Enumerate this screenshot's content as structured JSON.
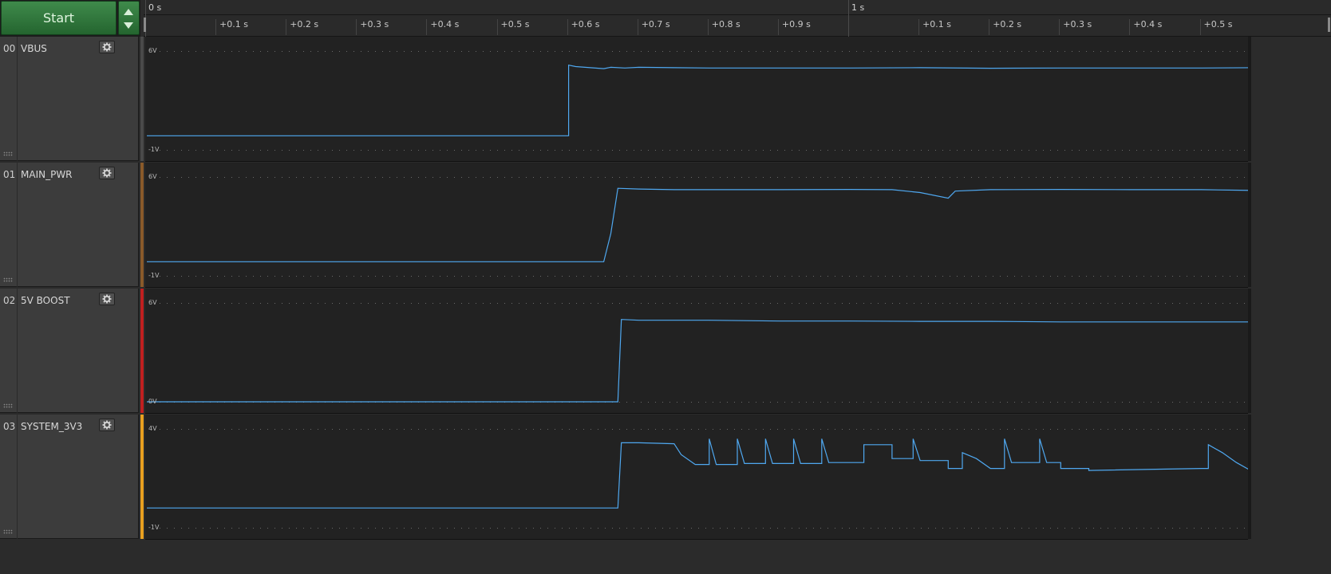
{
  "toolbar": {
    "start_label": "Start",
    "up_icon": "triangle-up-icon",
    "down_icon": "triangle-down-icon"
  },
  "timeline": {
    "major": [
      {
        "label": "0 s",
        "t": 0.0
      },
      {
        "label": "1 s",
        "t": 1.0
      }
    ],
    "minor": [
      {
        "label": "+0.1 s",
        "t": 0.1
      },
      {
        "label": "+0.2 s",
        "t": 0.2
      },
      {
        "label": "+0.3 s",
        "t": 0.3
      },
      {
        "label": "+0.4 s",
        "t": 0.4
      },
      {
        "label": "+0.5 s",
        "t": 0.5
      },
      {
        "label": "+0.6 s",
        "t": 0.6
      },
      {
        "label": "+0.7 s",
        "t": 0.7
      },
      {
        "label": "+0.8 s",
        "t": 0.8
      },
      {
        "label": "+0.9 s",
        "t": 0.9
      },
      {
        "label": "+0.1 s",
        "t": 1.1
      },
      {
        "label": "+0.2 s",
        "t": 1.2
      },
      {
        "label": "+0.3 s",
        "t": 1.3
      },
      {
        "label": "+0.4 s",
        "t": 1.4
      },
      {
        "label": "+0.5 s",
        "t": 1.5
      }
    ],
    "visible_range_s": [
      0.0,
      1.57
    ]
  },
  "channels": [
    {
      "number": "00",
      "name": "VBUS",
      "color": "#4a4a4a",
      "vmax_label": "6V",
      "vmin_label": "-1V",
      "vmin": -1,
      "vmax": 6,
      "trace_color": "#4fa8f0",
      "samples": [
        [
          0.0,
          0.0
        ],
        [
          0.6,
          0.0
        ],
        [
          0.6,
          5.0
        ],
        [
          0.61,
          4.9
        ],
        [
          0.65,
          4.75
        ],
        [
          0.66,
          4.85
        ],
        [
          0.68,
          4.8
        ],
        [
          0.7,
          4.85
        ],
        [
          0.75,
          4.82
        ],
        [
          0.8,
          4.8
        ],
        [
          0.9,
          4.8
        ],
        [
          1.0,
          4.8
        ],
        [
          1.1,
          4.82
        ],
        [
          1.2,
          4.78
        ],
        [
          1.3,
          4.8
        ],
        [
          1.4,
          4.8
        ],
        [
          1.5,
          4.8
        ],
        [
          1.57,
          4.82
        ]
      ]
    },
    {
      "number": "01",
      "name": "MAIN_PWR",
      "color": "#8a5a2a",
      "vmax_label": "6V",
      "vmin_label": "-1V",
      "vmin": -1,
      "vmax": 6,
      "trace_color": "#4fa8f0",
      "samples": [
        [
          0.0,
          0.0
        ],
        [
          0.65,
          0.0
        ],
        [
          0.66,
          2.0
        ],
        [
          0.67,
          5.2
        ],
        [
          0.7,
          5.15
        ],
        [
          0.75,
          5.1
        ],
        [
          0.8,
          5.1
        ],
        [
          0.9,
          5.1
        ],
        [
          1.0,
          5.12
        ],
        [
          1.06,
          5.1
        ],
        [
          1.1,
          4.9
        ],
        [
          1.14,
          4.5
        ],
        [
          1.15,
          5.0
        ],
        [
          1.2,
          5.1
        ],
        [
          1.3,
          5.12
        ],
        [
          1.4,
          5.1
        ],
        [
          1.5,
          5.1
        ],
        [
          1.57,
          5.05
        ]
      ]
    },
    {
      "number": "02",
      "name": "5V BOOST",
      "color": "#c02020",
      "vmax_label": "6V",
      "vmin_label": "0V",
      "vmin": 0,
      "vmax": 6,
      "trace_color": "#4fa8f0",
      "samples": [
        [
          0.0,
          0.0
        ],
        [
          0.6,
          0.0
        ],
        [
          0.67,
          0.0
        ],
        [
          0.675,
          5.0
        ],
        [
          0.7,
          4.95
        ],
        [
          0.8,
          4.95
        ],
        [
          0.9,
          4.9
        ],
        [
          1.0,
          4.9
        ],
        [
          1.1,
          4.88
        ],
        [
          1.2,
          4.88
        ],
        [
          1.3,
          4.85
        ],
        [
          1.4,
          4.85
        ],
        [
          1.5,
          4.85
        ],
        [
          1.57,
          4.85
        ]
      ]
    },
    {
      "number": "03",
      "name": "SYSTEM_3V3",
      "color": "#e8a020",
      "vmax_label": "4V",
      "vmin_label": "-1V",
      "vmin": -1,
      "vmax": 4,
      "trace_color": "#4fa8f0",
      "samples": [
        [
          0.0,
          0.0
        ],
        [
          0.67,
          0.0
        ],
        [
          0.675,
          3.3
        ],
        [
          0.7,
          3.3
        ],
        [
          0.75,
          3.25
        ],
        [
          0.76,
          2.7
        ],
        [
          0.78,
          2.2
        ],
        [
          0.8,
          2.2
        ],
        [
          0.8,
          3.5
        ],
        [
          0.81,
          2.2
        ],
        [
          0.84,
          2.2
        ],
        [
          0.84,
          3.5
        ],
        [
          0.85,
          2.25
        ],
        [
          0.88,
          2.25
        ],
        [
          0.88,
          3.5
        ],
        [
          0.89,
          2.25
        ],
        [
          0.92,
          2.25
        ],
        [
          0.92,
          3.5
        ],
        [
          0.93,
          2.25
        ],
        [
          0.96,
          2.25
        ],
        [
          0.96,
          3.5
        ],
        [
          0.97,
          2.3
        ],
        [
          1.02,
          2.3
        ],
        [
          1.02,
          3.2
        ],
        [
          1.06,
          3.2
        ],
        [
          1.06,
          2.5
        ],
        [
          1.09,
          2.5
        ],
        [
          1.09,
          3.5
        ],
        [
          1.1,
          2.4
        ],
        [
          1.14,
          2.4
        ],
        [
          1.14,
          2.0
        ],
        [
          1.16,
          2.0
        ],
        [
          1.16,
          2.8
        ],
        [
          1.18,
          2.5
        ],
        [
          1.2,
          2.0
        ],
        [
          1.22,
          2.0
        ],
        [
          1.22,
          3.5
        ],
        [
          1.23,
          2.3
        ],
        [
          1.27,
          2.3
        ],
        [
          1.27,
          3.5
        ],
        [
          1.28,
          2.3
        ],
        [
          1.3,
          2.3
        ],
        [
          1.3,
          2.0
        ],
        [
          1.34,
          2.0
        ],
        [
          1.34,
          1.9
        ],
        [
          1.5,
          2.0
        ],
        [
          1.51,
          2.0
        ],
        [
          1.51,
          3.2
        ],
        [
          1.53,
          2.8
        ],
        [
          1.55,
          2.3
        ],
        [
          1.57,
          1.9
        ]
      ]
    }
  ]
}
